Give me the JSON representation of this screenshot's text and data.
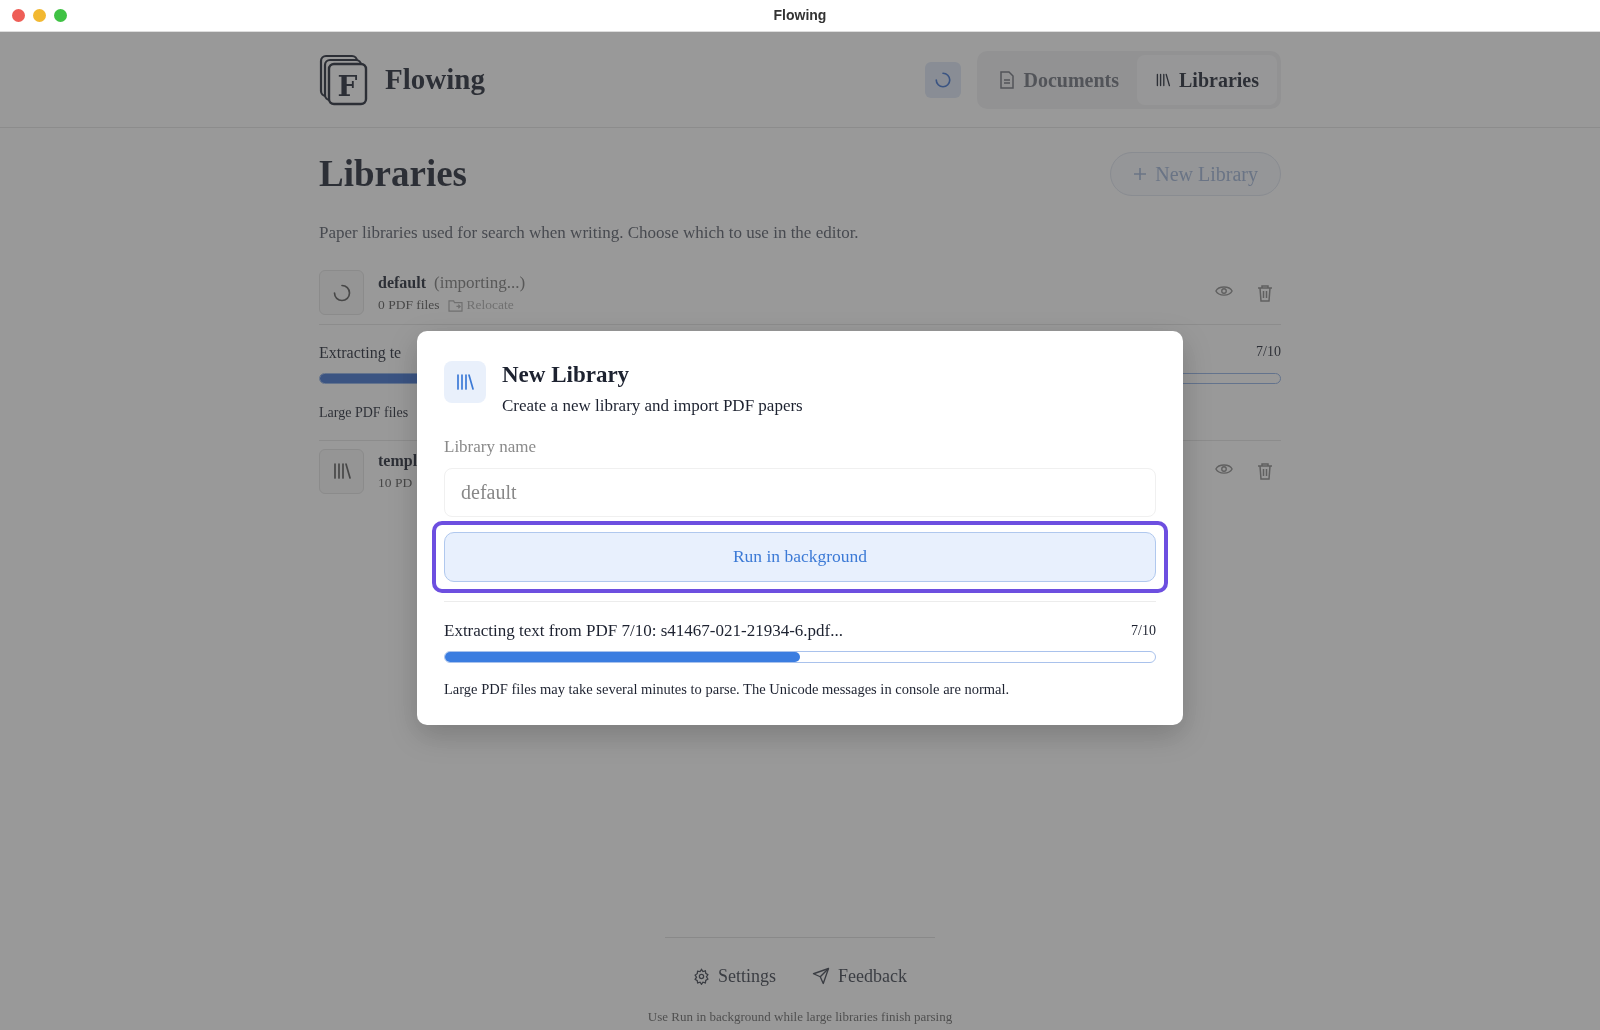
{
  "window": {
    "title": "Flowing"
  },
  "header": {
    "app_name": "Flowing",
    "logo_letter": "F",
    "syncing": true,
    "nav": [
      {
        "label": "Documents",
        "selected": false
      },
      {
        "label": "Libraries",
        "selected": true
      }
    ]
  },
  "page": {
    "title": "Libraries",
    "new_button": "New Library",
    "description": "Paper libraries used for search when writing. Choose which to use in the editor."
  },
  "libraries": [
    {
      "kind": "importing",
      "name": "default",
      "status": "(importing...)",
      "files": "0 PDF files",
      "relocate": "Relocate"
    },
    {
      "kind": "ready",
      "name": "templ",
      "files": "10 PD"
    }
  ],
  "import_progress": {
    "label": "Extracting te",
    "count": "7/10",
    "level": 0.7,
    "note": "Large PDF files"
  },
  "modal": {
    "title": "New Library",
    "subtitle": "Create a new library and import PDF papers",
    "field_label": "Library name",
    "field_value": "default",
    "button": "Run in background",
    "highlighted": true,
    "progress": {
      "label": "Extracting text from PDF 7/10: s41467-021-21934-6.pdf...",
      "count": "7/10",
      "level": 0.5,
      "note": "Large PDF files may take several minutes to parse. The Unicode messages in console are normal."
    }
  },
  "footer": {
    "links": [
      {
        "label": "Settings"
      },
      {
        "label": "Feedback"
      }
    ],
    "hint": "Use Run in background while large libraries finish parsing"
  }
}
